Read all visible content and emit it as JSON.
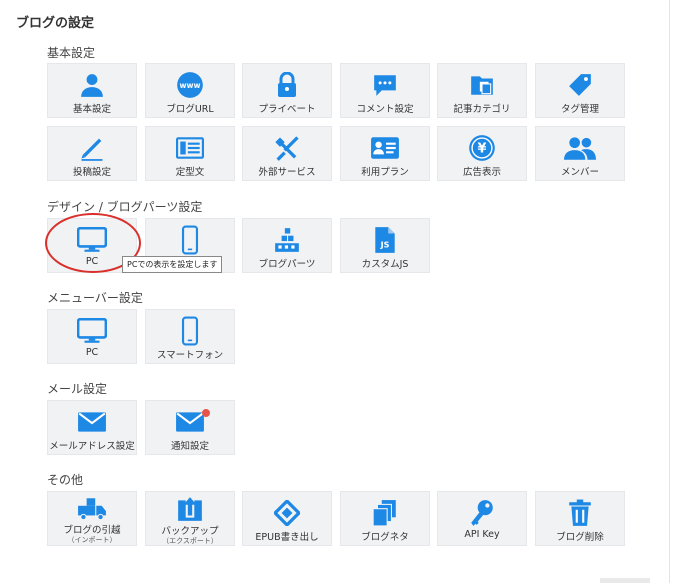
{
  "page_title": "ブログの設定",
  "accent": "#1e88e5",
  "annotation_color": "#d9302b",
  "sections": {
    "basic": {
      "title": "基本設定",
      "items": [
        "基本設定",
        "ブログURL",
        "プライベート",
        "コメント設定",
        "記事カテゴリ",
        "タグ管理",
        "投稿設定",
        "定型文",
        "外部サービス",
        "利用プラン",
        "広告表示",
        "メンバー"
      ]
    },
    "design": {
      "title": "デザイン / ブログパーツ設定",
      "items": [
        "PC",
        "",
        "ブログパーツ",
        "カスタムJS"
      ],
      "tooltip": "PCでの表示を設定します"
    },
    "menubar": {
      "title": "メニューバー設定",
      "items": [
        "PC",
        "スマートフォン"
      ]
    },
    "mail": {
      "title": "メール設定",
      "items": [
        "メールアドレス設定",
        "通知設定"
      ]
    },
    "other": {
      "title": "その他",
      "items": [
        "ブログの引越",
        "バックアップ",
        "EPUB書き出し",
        "ブログネタ",
        "API Key",
        "ブログ削除"
      ],
      "subs": [
        "（インポート）",
        "（エクスポート）"
      ]
    }
  },
  "icons": {
    "basic": [
      "user-icon",
      "www-icon",
      "lock-icon",
      "comment-icon",
      "folder-icon",
      "tag-icon",
      "pencil-icon",
      "template-icon",
      "tools-icon",
      "id-card-icon",
      "yen-icon",
      "members-icon"
    ],
    "design": [
      "monitor-icon",
      "smartphone-icon",
      "blocks-icon",
      "js-file-icon"
    ],
    "menubar": [
      "monitor-icon",
      "smartphone-icon"
    ],
    "mail": [
      "mail-icon",
      "mail-notify-icon"
    ],
    "other": [
      "truck-icon",
      "upload-box-icon",
      "epub-icon",
      "documents-icon",
      "key-icon",
      "trash-icon"
    ]
  }
}
